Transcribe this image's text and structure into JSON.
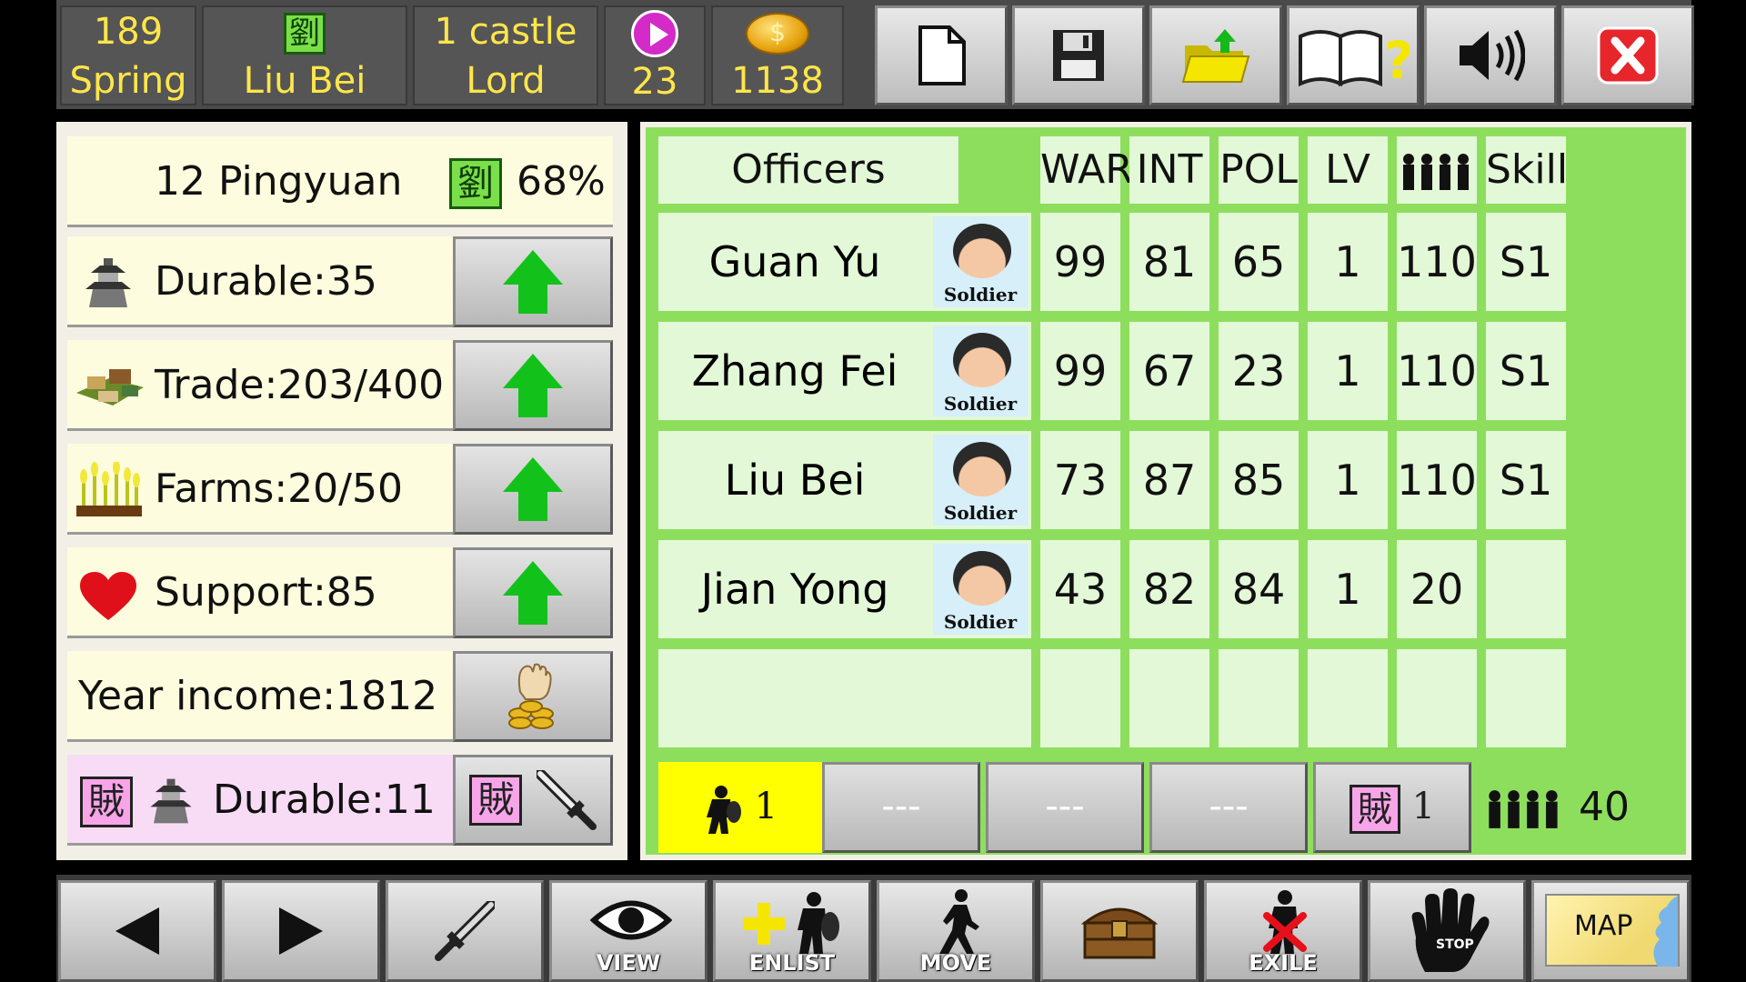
{
  "topbar": {
    "year": "189",
    "season": "Spring",
    "ruler_seal": "劉",
    "ruler": "Liu Bei",
    "castles": "1 castle",
    "rank": "Lord",
    "turns": "23",
    "gold": "1138",
    "icons": [
      "new-file-icon",
      "save-icon",
      "open-folder-icon",
      "help-book-icon",
      "speaker-icon",
      "close-icon"
    ]
  },
  "city": {
    "name": "12 Pingyuan",
    "seal": "劉",
    "loyalty": "68%",
    "durable": "Durable:35",
    "trade": "Trade:203/400",
    "farms": "Farms:20/50",
    "support": "Support:85",
    "income": "Year income:1812",
    "bandit_seal": "賊",
    "bandit_durable": "Durable:11"
  },
  "table": {
    "headers": [
      "Officers",
      "WAR",
      "INT",
      "POL",
      "LV",
      "Skill"
    ],
    "unit_label": "Soldier",
    "rows": [
      {
        "name": "Guan Yu",
        "war": "99",
        "int": "81",
        "pol": "65",
        "lv": "1",
        "troops": "110",
        "skill": "S1"
      },
      {
        "name": "Zhang Fei",
        "war": "99",
        "int": "67",
        "pol": "23",
        "lv": "1",
        "troops": "110",
        "skill": "S1"
      },
      {
        "name": "Liu Bei",
        "war": "73",
        "int": "87",
        "pol": "85",
        "lv": "1",
        "troops": "110",
        "skill": "S1"
      },
      {
        "name": "Jian Yong",
        "war": "43",
        "int": "82",
        "pol": "84",
        "lv": "1",
        "troops": "20",
        "skill": ""
      }
    ]
  },
  "footer": {
    "soldier_count": "1",
    "empty1": "---",
    "empty2": "---",
    "empty3": "---",
    "bandit_seal": "賊",
    "bandit_count": "1",
    "troops_total": "40"
  },
  "bottombar": {
    "view": "VIEW",
    "enlist": "ENLIST",
    "move": "MOVE",
    "exile": "EXILE",
    "stop": "STOP",
    "map": "MAP"
  },
  "colors": {
    "panel_green": "#8ede5e",
    "cell": "#e3f8d7",
    "yellow_text": "#ffe64a",
    "arrow_green": "#12c21b"
  }
}
